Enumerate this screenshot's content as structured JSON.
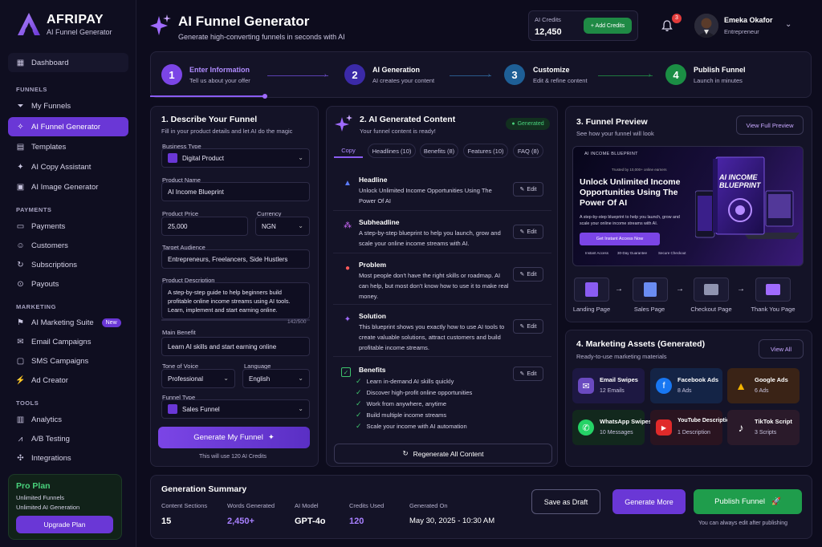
{
  "brand": {
    "name": "AFRIPAY",
    "sub": "AI Funnel Generator"
  },
  "sidebar": {
    "dashboard": "Dashboard",
    "funnels_header": "FUNNELS",
    "my_funnels": "My Funnels",
    "ai_funnel_generator": "AI Funnel Generator",
    "templates": "Templates",
    "ai_copy": "AI Copy Assistant",
    "ai_image": "AI Image Generator",
    "payments_header": "PAYMENTS",
    "payments": "Payments",
    "customers": "Customers",
    "subscriptions": "Subscriptions",
    "payouts": "Payouts",
    "marketing_header": "MARKETING",
    "marketing_suite": "AI Marketing Suite",
    "new_badge": "New",
    "email": "Email Campaigns",
    "sms": "SMS Campaigns",
    "ad_creator": "Ad Creator",
    "tools_header": "TOOLS",
    "analytics": "Analytics",
    "ab_testing": "A/B Testing",
    "integrations": "Integrations",
    "plan_title": "Pro Plan",
    "plan_line1": "Unlimited Funnels",
    "plan_line2": "Unlimited AI Generation",
    "upgrade": "Upgrade Plan"
  },
  "header": {
    "title": "AI Funnel Generator",
    "subtitle": "Generate high-converting funnels in seconds with AI",
    "credits_label": "AI Credits",
    "credits_value": "12,450",
    "add_credits": "+ Add Credits",
    "notif_count": "3",
    "user_name": "Emeka Okafor",
    "user_role": "Entrepreneur"
  },
  "steps": [
    {
      "num": "1",
      "title": "Enter Information",
      "sub": "Tell us about your offer"
    },
    {
      "num": "2",
      "title": "AI Generation",
      "sub": "AI creates your content"
    },
    {
      "num": "3",
      "title": "Customize",
      "sub": "Edit & refine content"
    },
    {
      "num": "4",
      "title": "Publish Funnel",
      "sub": "Launch in minutes"
    }
  ],
  "describe": {
    "title": "1. Describe Your Funnel",
    "sub": "Fill in your product details and let AI do the magic",
    "business_type_label": "Business Type",
    "business_type": "Digital Product",
    "product_name_label": "Product Name",
    "product_name": "AI Income Blueprint",
    "price_label": "Product Price",
    "price": "25,000",
    "currency_label": "Currency",
    "currency": "NGN",
    "audience_label": "Target Audience",
    "audience": "Entrepreneurs, Freelancers, Side Hustlers",
    "desc_label": "Product Description",
    "desc": "A step-by-step guide to help beginners build profitable online income streams using AI tools. Learn, implement and start earning online.",
    "desc_count": "142/500",
    "benefit_label": "Main Benefit",
    "benefit": "Learn AI skills and start earning online",
    "tone_label": "Tone of Voice",
    "tone": "Professional",
    "language_label": "Language",
    "language": "English",
    "funnel_type_label": "Funnel Type",
    "funnel_type": "Sales Funnel",
    "generate": "Generate My Funnel",
    "note": "This will use 120 AI Credits"
  },
  "generated": {
    "title": "2. AI Generated Content",
    "sub": "Your funnel content is ready!",
    "badge": "Generated",
    "tabs": [
      "Copy",
      "Headlines (10)",
      "Benefits (8)",
      "Features (10)",
      "FAQ (8)"
    ],
    "edit": "Edit",
    "headline_h": "Headline",
    "headline_t": "Unlock Unlimited Income Opportunities Using The Power Of AI",
    "subheadline_h": "Subheadline",
    "subheadline_t": "A step-by-step blueprint to help you launch, grow and scale your online income streams with AI.",
    "problem_h": "Problem",
    "problem_t": "Most people don't have the right skills or roadmap. AI can help, but most don't know how to use it to make real money.",
    "solution_h": "Solution",
    "solution_t": "This blueprint shows you exactly how to use AI tools to create valuable solutions, attract customers and build profitable income streams.",
    "benefits_h": "Benefits",
    "benefits": [
      "Learn in-demand AI skills quickly",
      "Discover high-profit online opportunities",
      "Work from anywhere, anytime",
      "Build multiple income streams",
      "Scale your income with AI automation"
    ],
    "regenerate": "Regenerate All Content"
  },
  "preview": {
    "title": "3. Funnel Preview",
    "sub": "See how your funnel will look",
    "view_full": "View Full Preview",
    "mock_brand": "AI INCOME BLUEPRINT",
    "mock_trusted": "Trusted by 10,000+ online earners",
    "mock_headline": "Unlock Unlimited Income Opportunities Using The Power Of AI",
    "mock_sub": "A step-by-step blueprint to help you launch, grow and scale your online income streams with AI.",
    "mock_cta": "Get Instant Access Now",
    "mock_f1": "Instant Access",
    "mock_f2": "30-Day Guarantee",
    "mock_f3": "Secure Checkout",
    "book_title": "AI INCOME BLUEPRINT",
    "pages": [
      "Landing Page",
      "Sales Page",
      "Checkout Page",
      "Thank You Page"
    ]
  },
  "assets": {
    "title": "4. Marketing Assets (Generated)",
    "sub": "Ready-to-use marketing materials",
    "view_all": "View All",
    "items": [
      {
        "name": "Email Swipes",
        "count": "12 Emails"
      },
      {
        "name": "Facebook Ads",
        "count": "8 Ads"
      },
      {
        "name": "Google Ads",
        "count": "6 Ads"
      },
      {
        "name": "WhatsApp Swipes",
        "count": "10 Messages"
      },
      {
        "name": "YouTube Description",
        "count": "1 Description"
      },
      {
        "name": "TikTok Script",
        "count": "3 Scripts"
      }
    ]
  },
  "summary": {
    "title": "Generation Summary",
    "sections_label": "Content Sections",
    "sections": "15",
    "words_label": "Words Generated",
    "words": "2,450+",
    "model_label": "AI Model",
    "model": "GPT-4o",
    "credits_label": "Credits Used",
    "credits": "120",
    "date_label": "Generated On",
    "date": "May 30, 2025 - 10:30 AM",
    "save_draft": "Save as Draft",
    "generate_more": "Generate More",
    "publish": "Publish Funnel",
    "publish_note": "You can always edit after publishing"
  },
  "colors": {
    "accent": "#6a37d6",
    "success": "#1f9d4c",
    "bg": "#0d0c1d",
    "card": "#141327"
  }
}
